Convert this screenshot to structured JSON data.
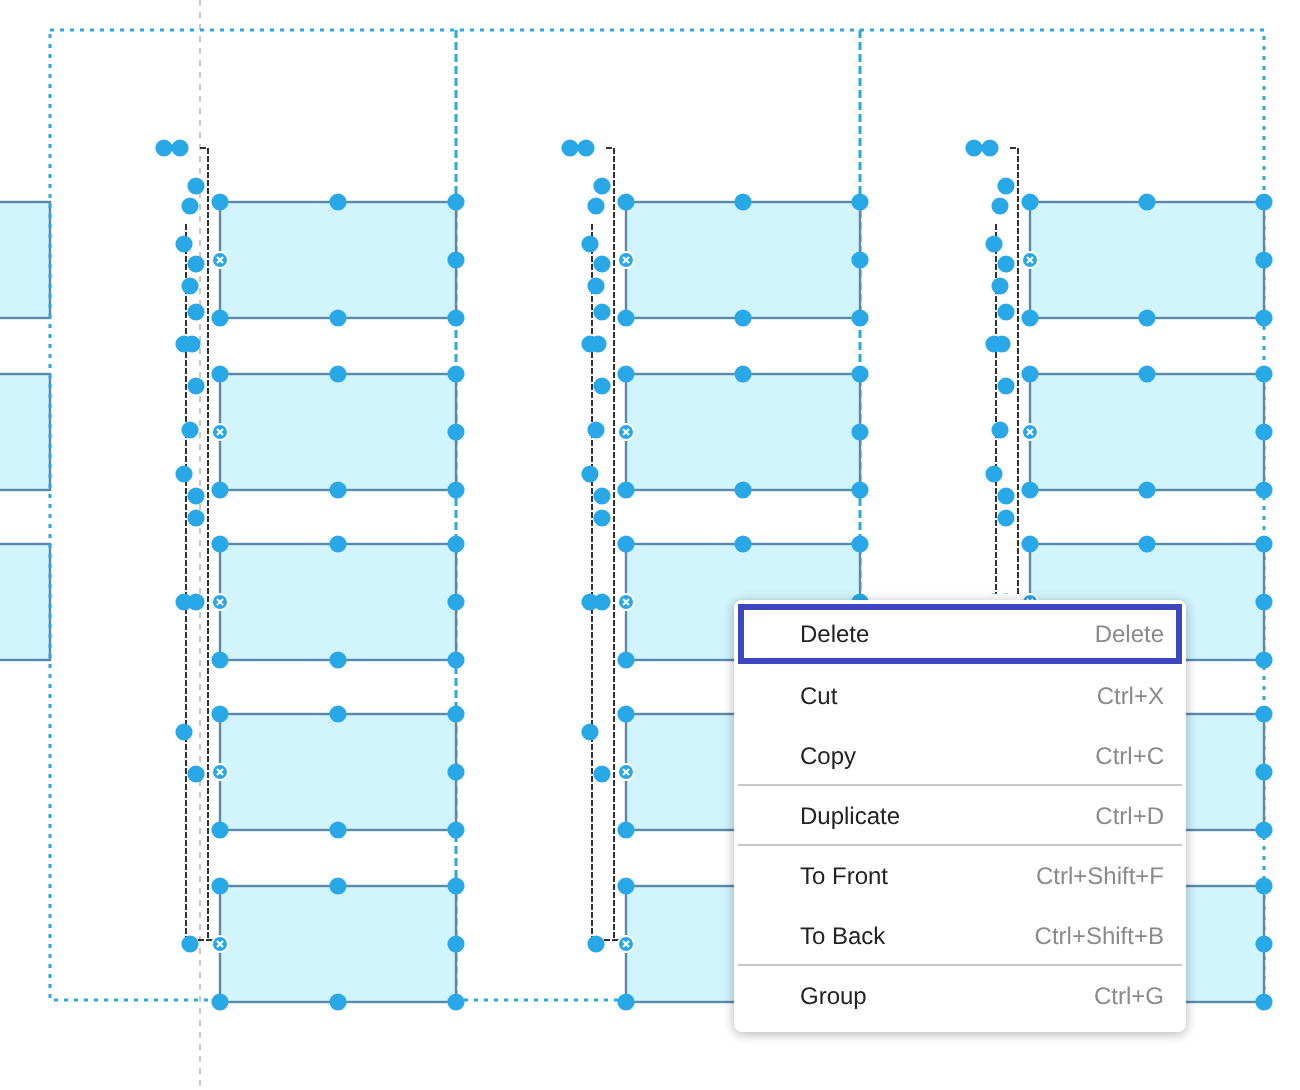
{
  "context_menu": {
    "items": [
      {
        "label": "Delete",
        "shortcut": "Delete",
        "selected": true,
        "divider_above": false
      },
      {
        "label": "Cut",
        "shortcut": "Ctrl+X",
        "selected": false,
        "divider_above": false
      },
      {
        "label": "Copy",
        "shortcut": "Ctrl+C",
        "selected": false,
        "divider_above": false
      },
      {
        "label": "Duplicate",
        "shortcut": "Ctrl+D",
        "selected": false,
        "divider_above": true
      },
      {
        "label": "To Front",
        "shortcut": "Ctrl+Shift+F",
        "selected": false,
        "divider_above": true
      },
      {
        "label": "To Back",
        "shortcut": "Ctrl+Shift+B",
        "selected": false,
        "divider_above": false
      },
      {
        "label": "Group",
        "shortcut": "Ctrl+G",
        "selected": false,
        "divider_above": true
      }
    ]
  }
}
